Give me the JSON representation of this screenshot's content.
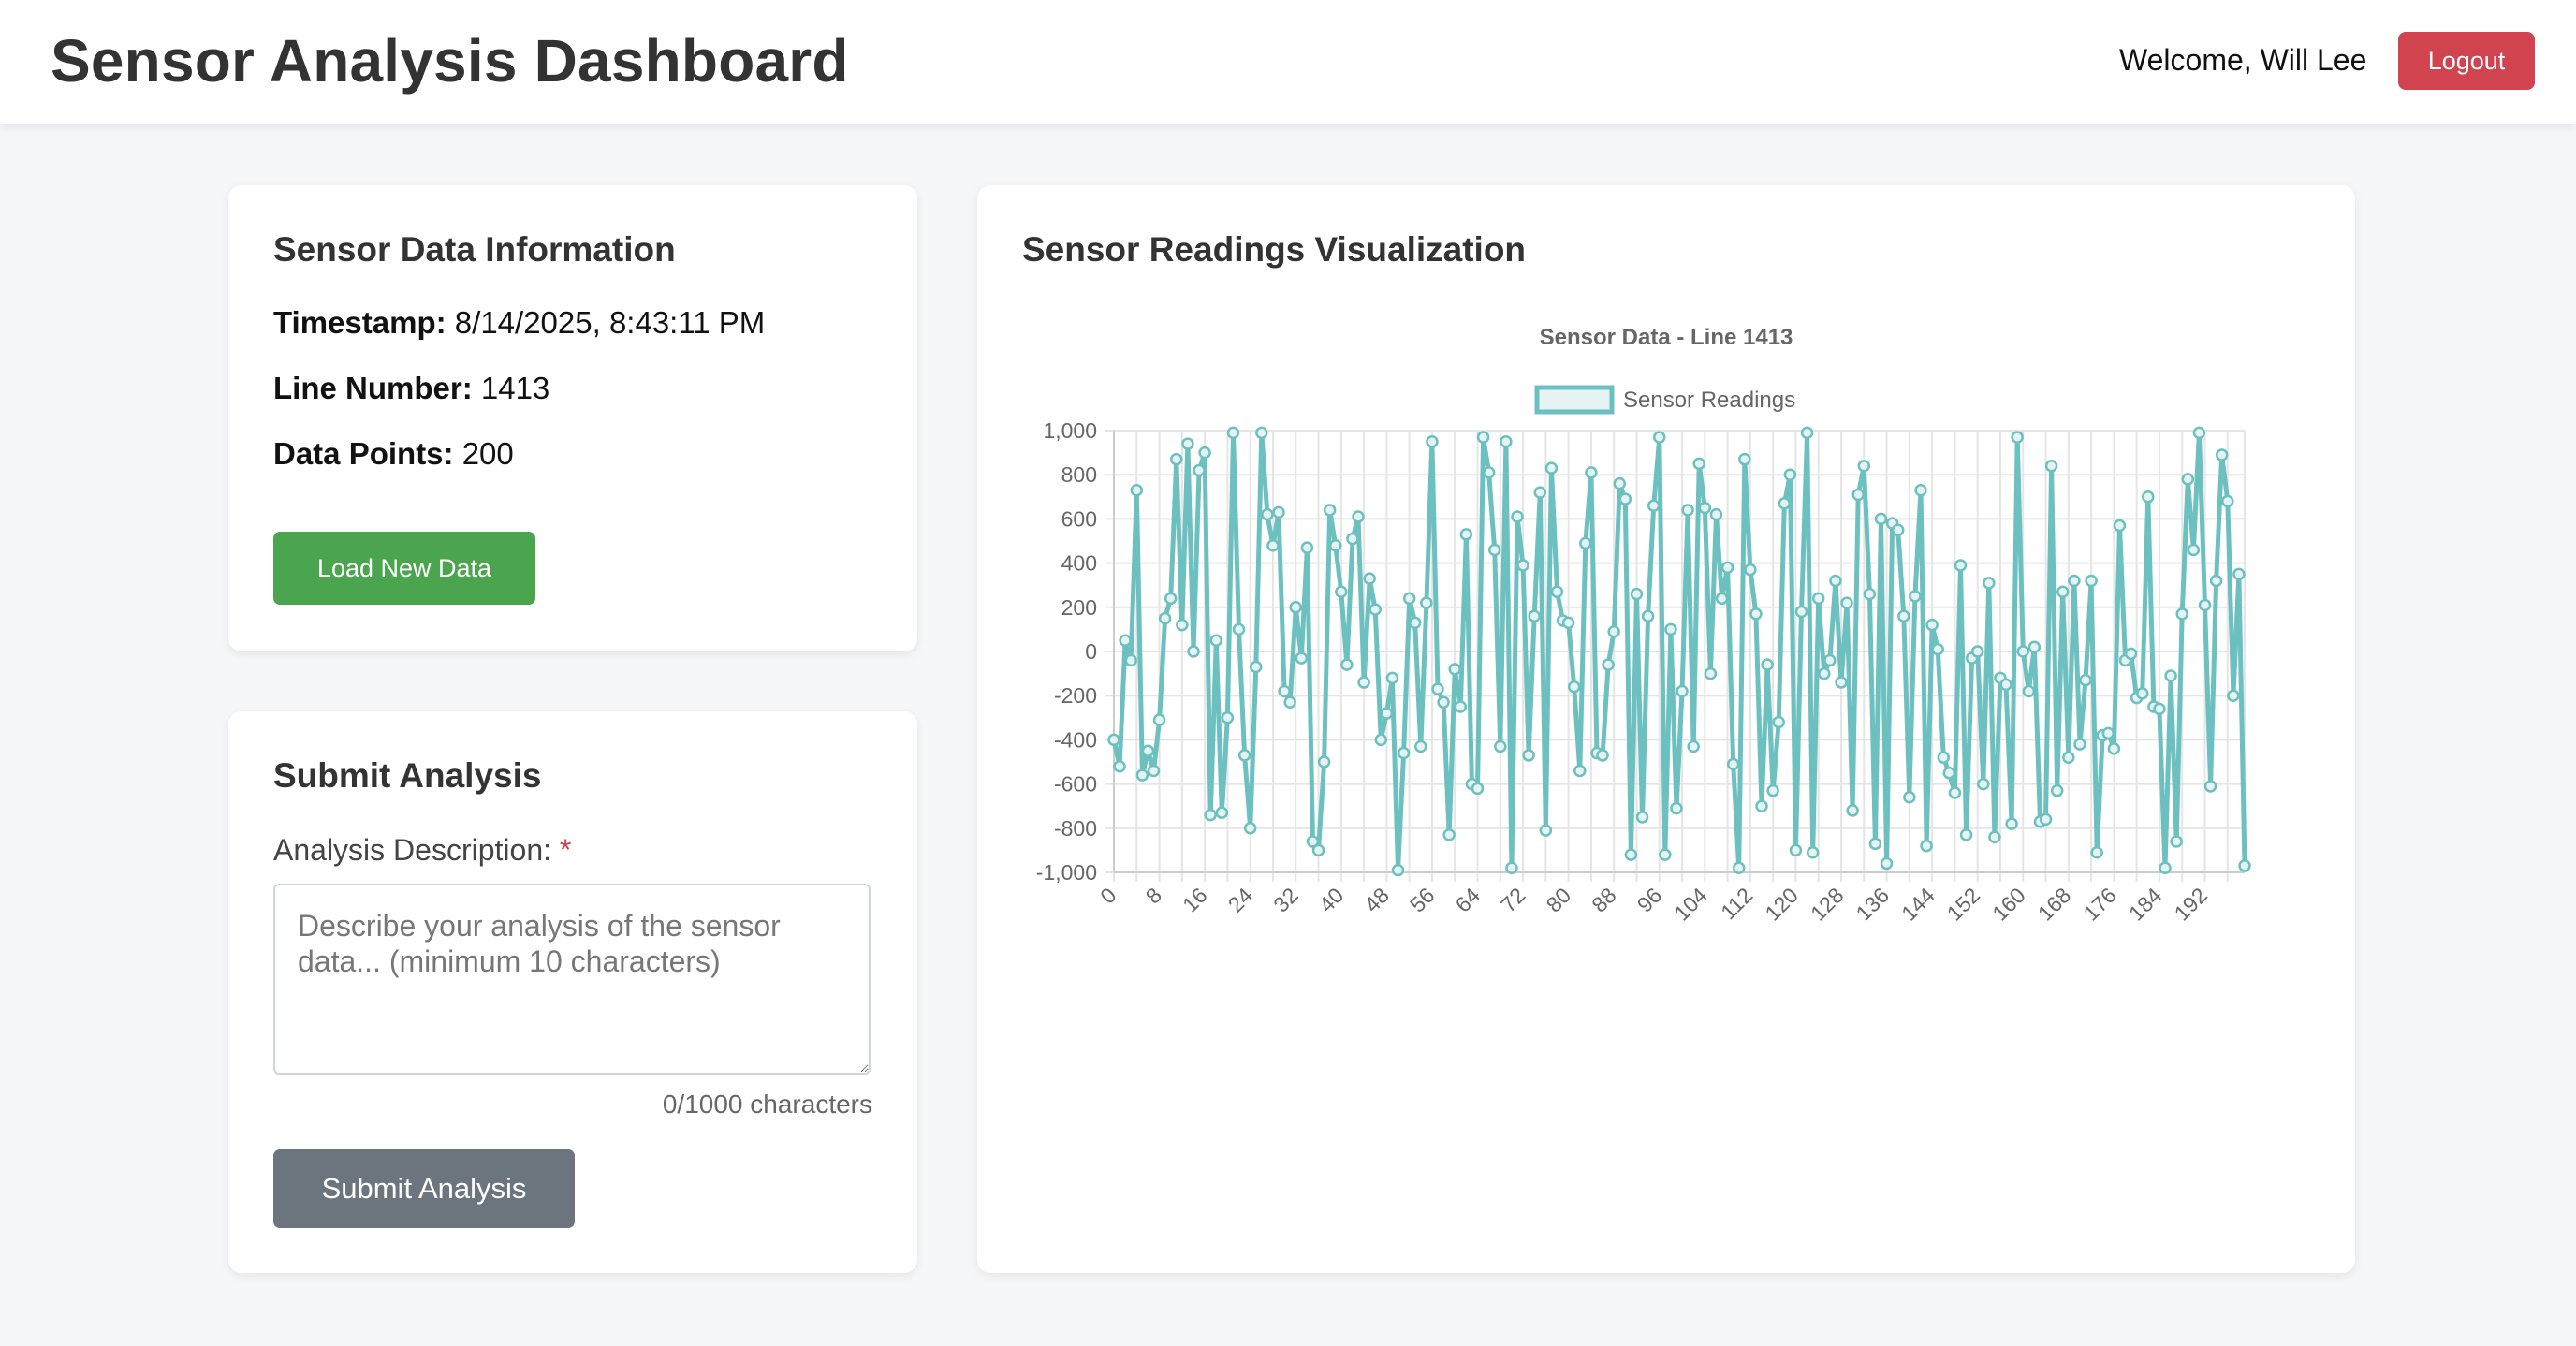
{
  "header": {
    "title": "Sensor Analysis Dashboard",
    "welcome": "Welcome, Will Lee",
    "logout_label": "Logout",
    "logout_color": "#d0434f"
  },
  "info": {
    "title": "Sensor Data Information",
    "timestamp_label": "Timestamp:",
    "timestamp_value": "8/14/2025, 8:43:11 PM",
    "line_label": "Line Number:",
    "line_value": "1413",
    "points_label": "Data Points:",
    "points_value": "200",
    "load_label": "Load New Data",
    "load_color": "#4aa54e"
  },
  "analysis": {
    "title": "Submit Analysis",
    "field_label": "Analysis Description:",
    "required_mark": "*",
    "placeholder": "Describe your analysis of the sensor data... (minimum 10 characters)",
    "value": "",
    "char_count": "0/1000 characters",
    "submit_label": "Submit Analysis",
    "submit_color": "#6c757d"
  },
  "visualization": {
    "title": "Sensor Readings Visualization"
  },
  "chart_data": {
    "type": "line",
    "title": "Sensor Data - Line 1413",
    "xlabel": "",
    "ylabel": "",
    "ylim": [
      -1000,
      1000
    ],
    "yticks": [
      "-1,000",
      "-800",
      "-600",
      "-400",
      "-200",
      "0",
      "200",
      "400",
      "600",
      "800",
      "1,000"
    ],
    "xticks": [
      "0",
      "8",
      "16",
      "24",
      "32",
      "40",
      "48",
      "56",
      "64",
      "72",
      "80",
      "88",
      "96",
      "104",
      "112",
      "120",
      "128",
      "136",
      "144",
      "152",
      "160",
      "168",
      "176",
      "184",
      "192"
    ],
    "grid": true,
    "legend": "top",
    "color": "#6cc0bf",
    "series": [
      {
        "name": "Sensor Readings",
        "values": [
          -400,
          -520,
          50,
          -40,
          730,
          -560,
          -450,
          -540,
          -310,
          150,
          240,
          870,
          120,
          940,
          0,
          820,
          900,
          -740,
          50,
          -730,
          -300,
          990,
          100,
          -470,
          -800,
          -70,
          990,
          620,
          480,
          630,
          -180,
          -230,
          200,
          -30,
          470,
          -860,
          -900,
          -500,
          640,
          480,
          270,
          -60,
          510,
          610,
          -140,
          330,
          190,
          -400,
          -280,
          -120,
          -990,
          -460,
          240,
          130,
          -430,
          220,
          950,
          -170,
          -230,
          -830,
          -80,
          -250,
          530,
          -600,
          -620,
          970,
          810,
          460,
          -430,
          950,
          -980,
          610,
          390,
          -470,
          160,
          720,
          -810,
          830,
          270,
          140,
          130,
          -160,
          -540,
          490,
          810,
          -460,
          -470,
          -60,
          90,
          760,
          690,
          -920,
          260,
          -750,
          160,
          660,
          970,
          -920,
          100,
          -710,
          -180,
          640,
          -430,
          850,
          650,
          -100,
          620,
          240,
          380,
          -510,
          -980,
          870,
          370,
          170,
          -700,
          -60,
          -630,
          -320,
          670,
          800,
          -900,
          180,
          990,
          -910,
          240,
          -100,
          -40,
          320,
          -140,
          220,
          -720,
          710,
          840,
          260,
          -870,
          600,
          -960,
          580,
          550,
          160,
          -660,
          250,
          730,
          -880,
          120,
          10,
          -480,
          -550,
          -640,
          390,
          -830,
          -30,
          0,
          -600,
          310,
          -840,
          -120,
          -150,
          -780,
          970,
          0,
          -180,
          20,
          -770,
          -760,
          840,
          -630,
          270,
          -480,
          320,
          -420,
          -130,
          320,
          -910,
          -380,
          -370,
          -440,
          570,
          -40,
          -10,
          -210,
          -190,
          700,
          -250,
          -260,
          -980,
          -110,
          -860,
          170,
          780,
          460,
          990,
          210,
          -610,
          320,
          890,
          680,
          -200,
          350,
          -970
        ]
      }
    ]
  }
}
